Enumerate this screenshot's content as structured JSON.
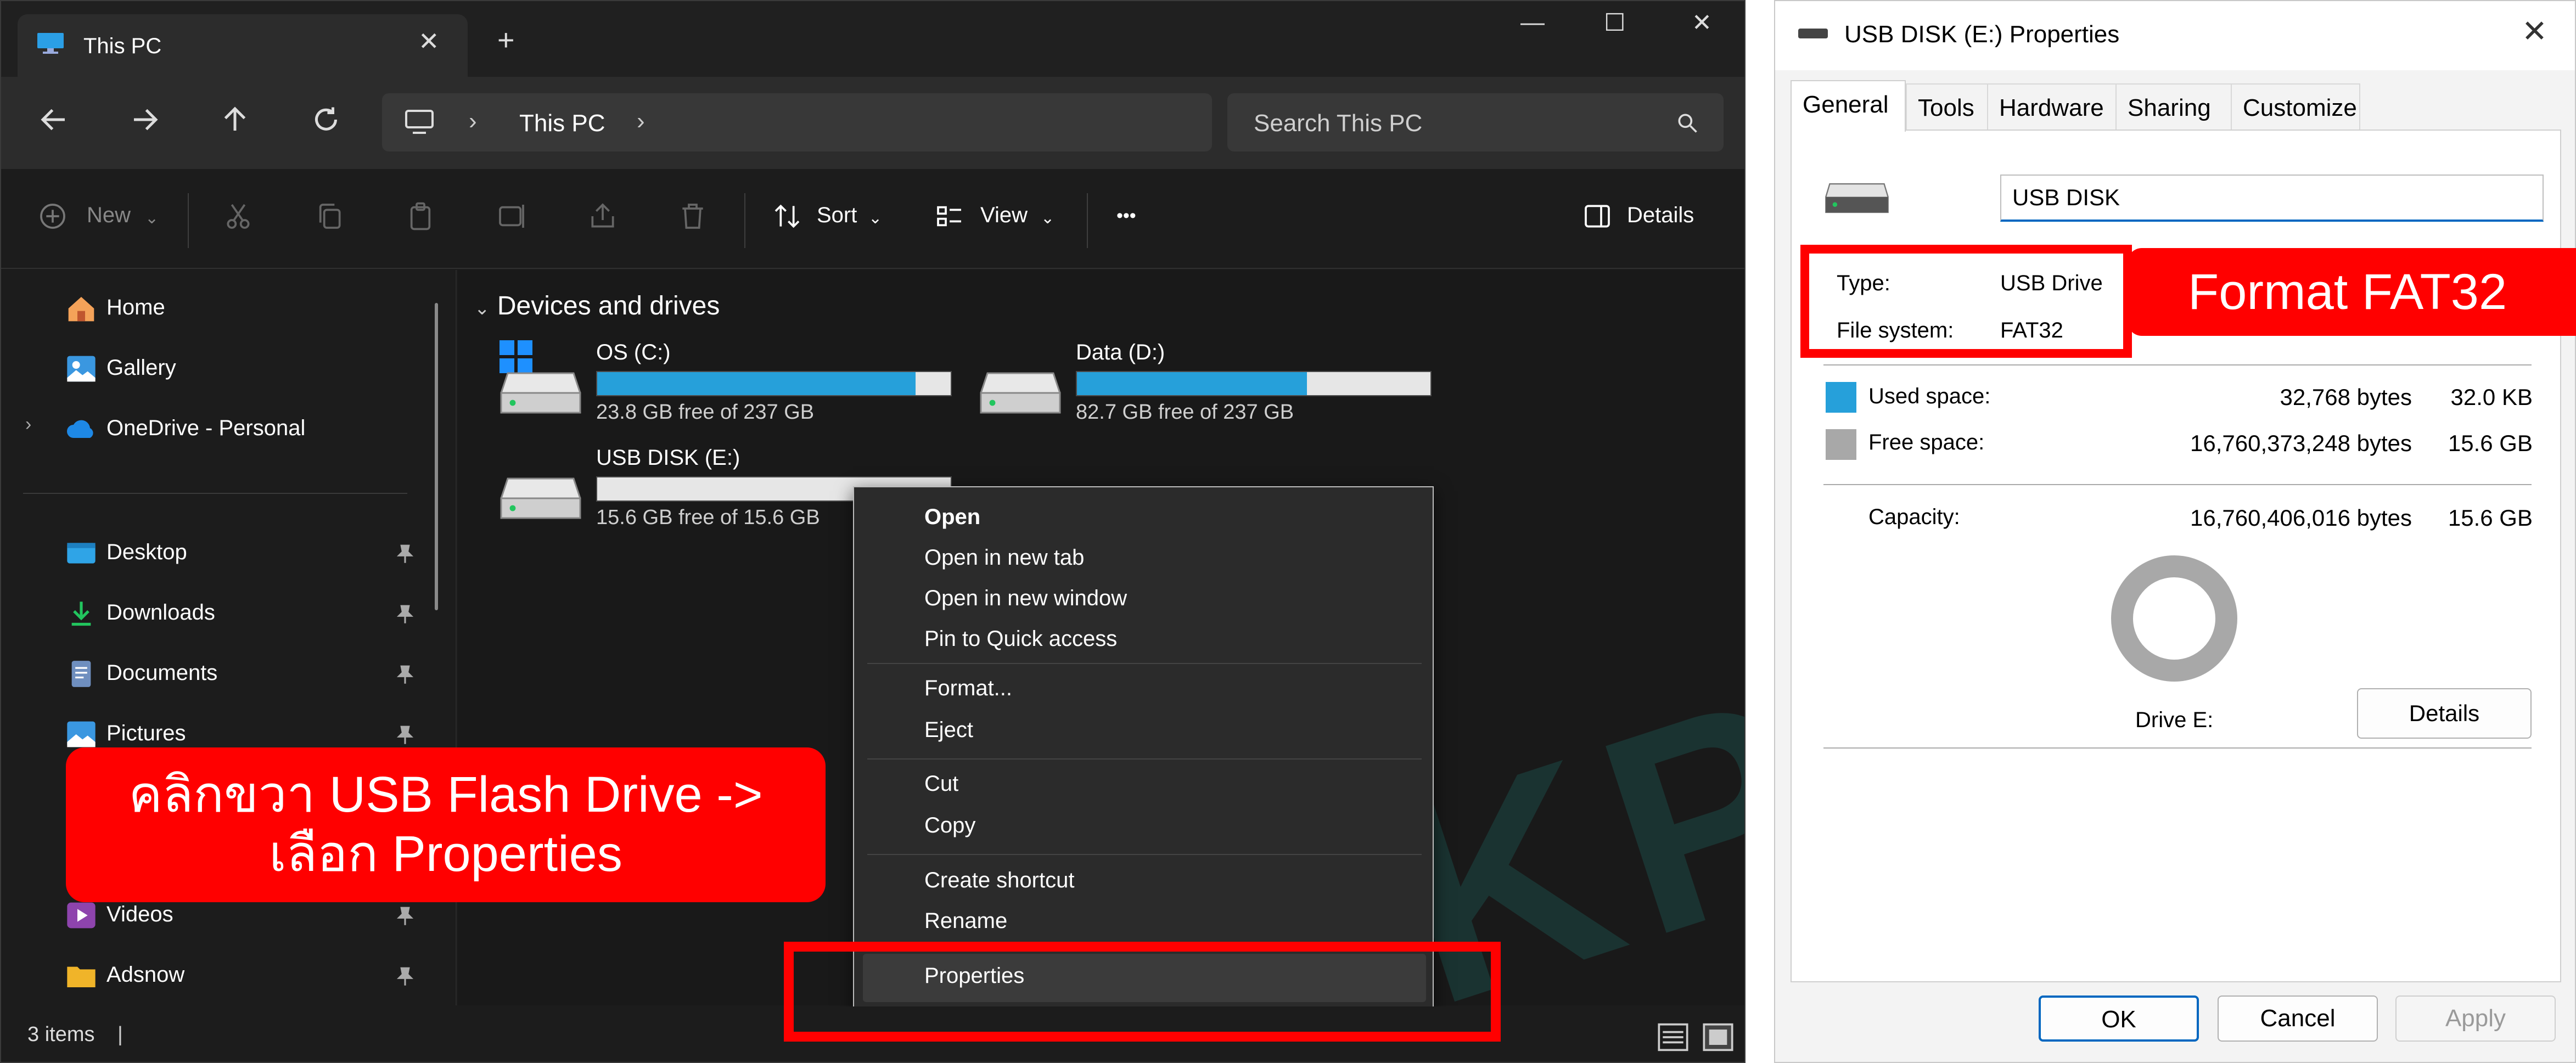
{
  "explorer": {
    "tab_title": "This PC",
    "tab_close": "✕",
    "new_tab": "+",
    "minimize": "—",
    "maximize": "☐",
    "close": "✕",
    "address_location": "This PC",
    "search_placeholder": "Search This PC",
    "commands": {
      "new": "New",
      "sort": "Sort",
      "view": "View",
      "more": "•••",
      "details": "Details"
    },
    "sidebar": {
      "items": [
        {
          "label": "Home"
        },
        {
          "label": "Gallery"
        },
        {
          "label": "OneDrive - Personal"
        },
        {
          "label": "Desktop"
        },
        {
          "label": "Downloads"
        },
        {
          "label": "Documents"
        },
        {
          "label": "Pictures"
        },
        {
          "label": "Videos"
        },
        {
          "label": "Adsnow"
        }
      ]
    },
    "group_header": "Devices and drives",
    "drives": [
      {
        "name": "OS (C:)",
        "free_text": "23.8 GB free of 237 GB",
        "used_fraction": 0.9
      },
      {
        "name": "Data (D:)",
        "free_text": "82.7 GB free of 237 GB",
        "used_fraction": 0.65
      },
      {
        "name": "USB DISK (E:)",
        "free_text": "15.6 GB free of 15.6 GB",
        "used_fraction": 0.0
      }
    ],
    "context_menu": {
      "open": "Open",
      "open_new_tab": "Open in new tab",
      "open_new_window": "Open in new window",
      "pin_quick": "Pin to Quick access",
      "format": "Format...",
      "eject": "Eject",
      "cut": "Cut",
      "copy": "Copy",
      "create_shortcut": "Create shortcut",
      "rename": "Rename",
      "properties": "Properties"
    },
    "status": "3 items",
    "watermark": "KPT"
  },
  "annotation_left": {
    "line1": "คลิกขวา USB Flash Drive ->",
    "line2": "เลือก Properties"
  },
  "annotation_right": "Format FAT32",
  "dialog": {
    "title": "USB DISK (E:) Properties",
    "close": "✕",
    "tabs": [
      "General",
      "Tools",
      "Hardware",
      "Sharing",
      "Customize"
    ],
    "drive_name": "USB DISK",
    "type_label": "Type:",
    "type_value": "USB Drive",
    "fs_label": "File system:",
    "fs_value": "FAT32",
    "used_label": "Used space:",
    "used_bytes": "32,768 bytes",
    "used_size": "32.0 KB",
    "free_label": "Free space:",
    "free_bytes": "16,760,373,248 bytes",
    "free_size": "15.6 GB",
    "capacity_label": "Capacity:",
    "capacity_bytes": "16,760,406,016 bytes",
    "capacity_size": "15.6 GB",
    "drive_label": "Drive E:",
    "details_button": "Details",
    "ok": "OK",
    "cancel": "Cancel",
    "apply": "Apply",
    "colors": {
      "used": "#26a0da",
      "free": "#a8a8a8"
    }
  }
}
